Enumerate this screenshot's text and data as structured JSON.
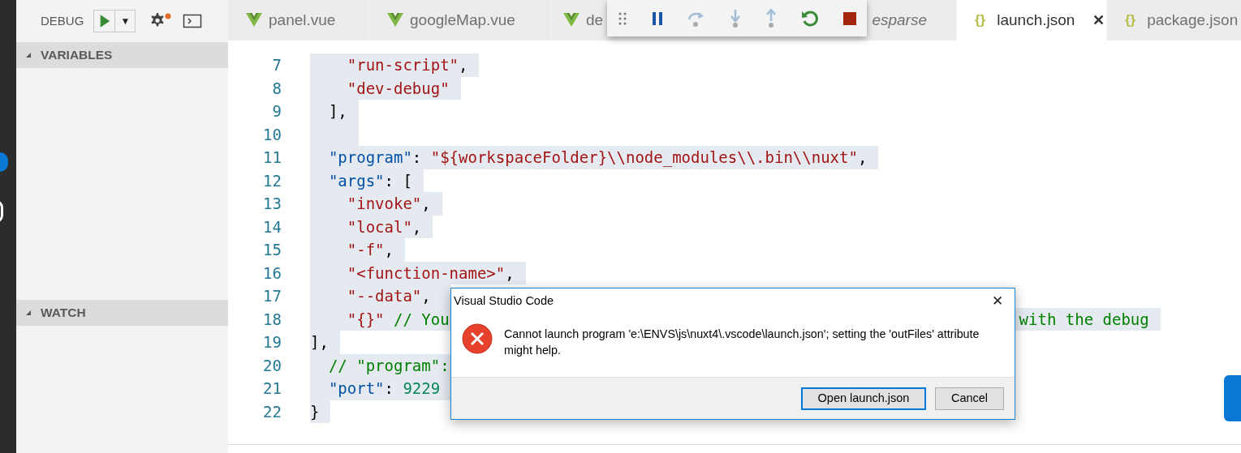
{
  "sidebar": {
    "title": "DEBUG",
    "run_button": {
      "dropdown": "▼"
    },
    "settings_badge": true,
    "sections": [
      {
        "title": "VARIABLES",
        "expanded": true
      },
      {
        "title": "WATCH",
        "expanded": true
      }
    ]
  },
  "activity_bar": {
    "badge": true
  },
  "tabs": [
    {
      "label": "panel.vue",
      "kind": "vue",
      "selected": false,
      "preview": false
    },
    {
      "label": "googleMap.vue",
      "kind": "vue",
      "selected": false,
      "preview": false
    },
    {
      "label": "de",
      "kind": "vue",
      "selected": false,
      "preview": false
    },
    {
      "label": "esparse",
      "kind": "plain",
      "selected": false,
      "preview": true
    },
    {
      "label": "launch.json",
      "kind": "json",
      "icon": "{}",
      "close": "✕",
      "selected": true,
      "preview": false
    },
    {
      "label": "package.json",
      "kind": "json",
      "icon": "{}",
      "selected": false,
      "preview": false
    }
  ],
  "debug_toolbar": [
    {
      "kind": "grip",
      "disabled": false
    },
    {
      "kind": "pause",
      "disabled": false
    },
    {
      "kind": "step-over",
      "disabled": true
    },
    {
      "kind": "step-into",
      "disabled": true
    },
    {
      "kind": "step-out",
      "disabled": true
    },
    {
      "kind": "restart",
      "disabled": false
    },
    {
      "kind": "stop",
      "disabled": false
    }
  ],
  "editor": {
    "lines": [
      {
        "number": "7",
        "tokens": [
          {
            "kind": "string",
            "text": "    \"run-script\""
          },
          {
            "kind": "punct",
            "text": ","
          }
        ]
      },
      {
        "number": "8",
        "tokens": [
          {
            "kind": "string",
            "text": "    \"dev-debug\""
          }
        ]
      },
      {
        "number": "9",
        "tokens": [
          {
            "kind": "punct",
            "text": "  ],"
          }
        ]
      },
      {
        "number": "10"
      },
      {
        "number": "11",
        "tokens": [
          {
            "kind": "key",
            "text": "  \"program\""
          },
          {
            "kind": "punct",
            "text": ": "
          },
          {
            "kind": "string",
            "text": "\"${workspaceFolder}\\\\node_modules\\\\.bin\\\\nuxt\""
          },
          {
            "kind": "punct",
            "text": ","
          }
        ]
      },
      {
        "number": "12",
        "tokens": [
          {
            "kind": "key",
            "text": "  \"args\""
          },
          {
            "kind": "punct",
            "text": ": ["
          }
        ]
      },
      {
        "number": "13",
        "tokens": [
          {
            "kind": "string",
            "text": "    \"invoke\""
          },
          {
            "kind": "punct",
            "text": ","
          }
        ]
      },
      {
        "number": "14",
        "tokens": [
          {
            "kind": "string",
            "text": "    \"local\""
          },
          {
            "kind": "punct",
            "text": ","
          }
        ]
      },
      {
        "number": "15",
        "tokens": [
          {
            "kind": "string",
            "text": "    \"-f\""
          },
          {
            "kind": "punct",
            "text": ","
          }
        ]
      },
      {
        "number": "16",
        "tokens": [
          {
            "kind": "string",
            "text": "    \"<function-name>\""
          },
          {
            "kind": "punct",
            "text": ","
          }
        ]
      },
      {
        "number": "17",
        "tokens": [
          {
            "kind": "string",
            "text": "    \"--data\""
          },
          {
            "kind": "punct",
            "text": ", "
          }
        ]
      },
      {
        "number": "18",
        "tokens": [
          {
            "kind": "string",
            "text": "    \"{}\""
          },
          {
            "kind": "comment",
            "text": " // You"
          }
        ],
        "tail": [
          {
            "kind": "comment",
            "text": "with the debug"
          }
        ]
      },
      {
        "number": "19",
        "tokens": [
          {
            "kind": "punct",
            "text": "],"
          }
        ]
      },
      {
        "number": "20",
        "tokens": [
          {
            "kind": "comment",
            "text": "  // \"program\":"
          }
        ]
      },
      {
        "number": "21",
        "tokens": [
          {
            "kind": "key",
            "text": "  \"port\""
          },
          {
            "kind": "punct",
            "text": ": "
          },
          {
            "kind": "number",
            "text": "9229"
          }
        ]
      },
      {
        "number": "22",
        "tokens": [
          {
            "kind": "punct",
            "text": "}"
          }
        ]
      }
    ]
  },
  "corner_button": {
    "kind": "notification"
  },
  "dialog": {
    "title": "Visual Studio Code",
    "close": "✕",
    "message": "Cannot launch program 'e:\\ENVS\\js\\nuxt4\\.vscode\\launch.json'; setting the 'outFiles' attribute might help.",
    "buttons": [
      {
        "label": "Open launch.json",
        "selected": true
      },
      {
        "label": "Cancel",
        "selected": false
      }
    ]
  }
}
